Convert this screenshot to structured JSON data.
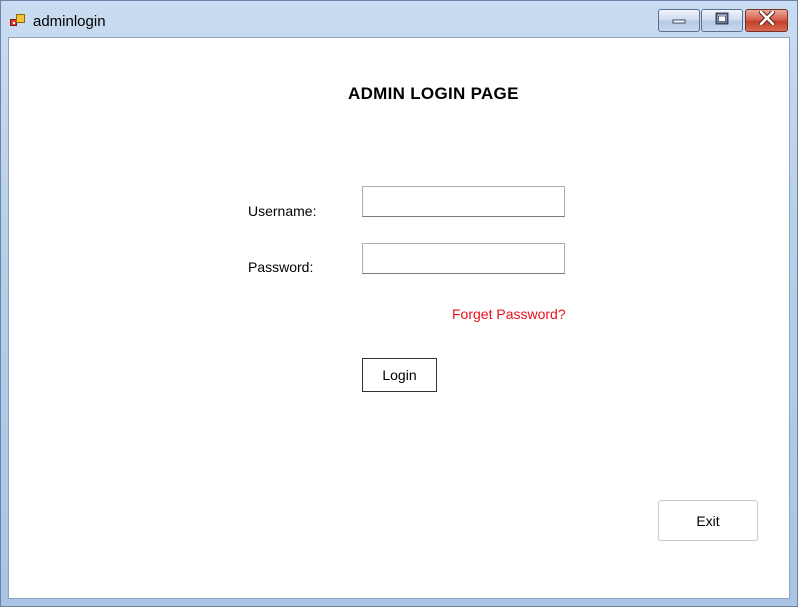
{
  "window": {
    "title": "adminlogin",
    "icon": "app-form-icon",
    "controls": {
      "minimize": "minimize-icon",
      "maximize": "maximize-icon",
      "close": "close-icon"
    }
  },
  "form": {
    "heading": "ADMIN LOGIN PAGE",
    "username_label": "Username:",
    "username_value": "",
    "password_label": "Password:",
    "password_value": "",
    "forget_link": "Forget Password?",
    "login_button": "Login",
    "exit_button": "Exit"
  },
  "colors": {
    "link": "#e8111f",
    "titlebar": "#b7cfe9",
    "close_button": "#c2402b"
  }
}
